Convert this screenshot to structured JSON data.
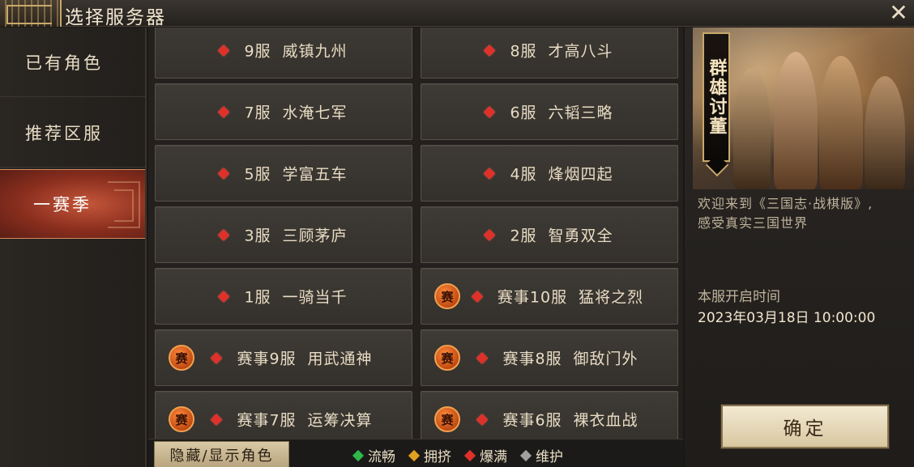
{
  "window": {
    "title": "选择服务器",
    "close_icon": "close-icon"
  },
  "sidebar": {
    "items": [
      {
        "label": "已有角色",
        "active": false
      },
      {
        "label": "推荐区服",
        "active": false
      },
      {
        "label": "一赛季",
        "active": true
      }
    ]
  },
  "servers": [
    {
      "badge": "",
      "status": "full",
      "label": "9服",
      "name": "威镇九州"
    },
    {
      "badge": "",
      "status": "full",
      "label": "8服",
      "name": "才高八斗"
    },
    {
      "badge": "",
      "status": "full",
      "label": "7服",
      "name": "水淹七军"
    },
    {
      "badge": "",
      "status": "full",
      "label": "6服",
      "name": "六韬三略"
    },
    {
      "badge": "",
      "status": "full",
      "label": "5服",
      "name": "学富五车"
    },
    {
      "badge": "",
      "status": "full",
      "label": "4服",
      "name": "烽烟四起"
    },
    {
      "badge": "",
      "status": "full",
      "label": "3服",
      "name": "三顾茅庐"
    },
    {
      "badge": "",
      "status": "full",
      "label": "2服",
      "name": "智勇双全"
    },
    {
      "badge": "",
      "status": "full",
      "label": "1服",
      "name": "一骑当千"
    },
    {
      "badge": "赛",
      "status": "full",
      "label": "赛事10服",
      "name": "猛将之烈"
    },
    {
      "badge": "赛",
      "status": "full",
      "label": "赛事9服",
      "name": "用武通神"
    },
    {
      "badge": "赛",
      "status": "full",
      "label": "赛事8服",
      "name": "御敌门外"
    },
    {
      "badge": "赛",
      "status": "full",
      "label": "赛事7服",
      "name": "运筹决算"
    },
    {
      "badge": "赛",
      "status": "full",
      "label": "赛事6服",
      "name": "裸衣血战"
    }
  ],
  "bottom": {
    "toggle_label": "隐藏/显示角色",
    "legend": [
      {
        "label": "流畅",
        "color": "#2fb84a"
      },
      {
        "label": "拥挤",
        "color": "#e0a020"
      },
      {
        "label": "爆满",
        "color": "#e0302a"
      },
      {
        "label": "维护",
        "color": "#a0a0a0"
      }
    ]
  },
  "right": {
    "banner_title": "群雄讨董",
    "welcome_line1": "欢迎来到《三国志·战棋版》,",
    "welcome_line2": "感受真实三国世界",
    "open_label": "本服开启时间",
    "open_time": "2023年03月18日  10:00:00",
    "confirm_label": "确定"
  },
  "colors": {
    "full": "#e0302a",
    "accent": "#c9a86a",
    "active_tab": "#a63a24"
  }
}
